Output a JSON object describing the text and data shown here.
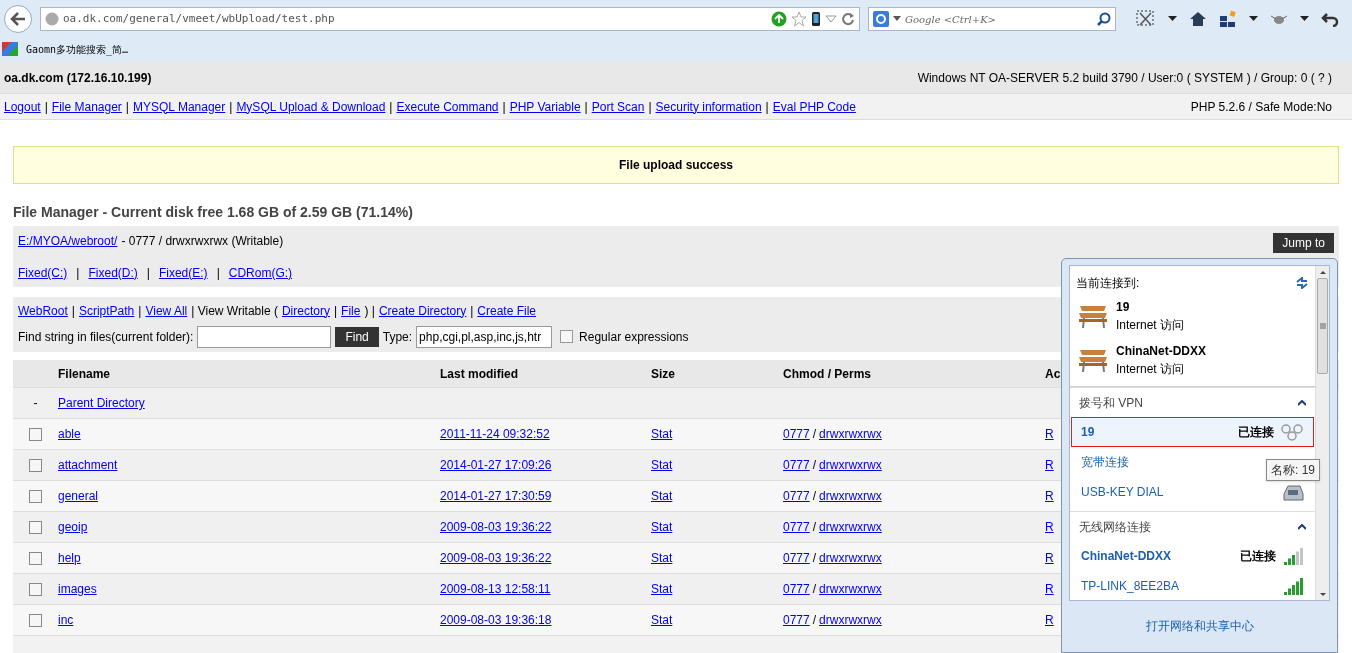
{
  "browser": {
    "url": "oa.dk.com/general/vmeet/wbUpload/test.php",
    "search_placeholder": "Google <Ctrl+K>",
    "bookmarks": [
      "Gaomn多功能搜索_简…"
    ]
  },
  "header": {
    "host": "oa.dk.com (172.16.10.199)",
    "system": "Windows NT OA-SERVER 5.2 build 3790 / User:0 ( SYSTEM ) / Group: 0 ( ? )",
    "nav": [
      {
        "kind": "link",
        "text": "Logout"
      },
      {
        "kind": "text",
        "text": "|"
      },
      {
        "kind": "link",
        "text": "File Manager"
      },
      {
        "kind": "text",
        "text": "|"
      },
      {
        "kind": "link",
        "text": "MYSQL Manager"
      },
      {
        "kind": "text",
        "text": "|"
      },
      {
        "kind": "link",
        "text": "MySQL Upload & Download"
      },
      {
        "kind": "text",
        "text": "|"
      },
      {
        "kind": "link",
        "text": "Execute Command"
      },
      {
        "kind": "text",
        "text": "|"
      },
      {
        "kind": "link",
        "text": "PHP Variable"
      },
      {
        "kind": "text",
        "text": "|"
      },
      {
        "kind": "link",
        "text": "Port Scan"
      },
      {
        "kind": "text",
        "text": "|"
      },
      {
        "kind": "link",
        "text": "Security information"
      },
      {
        "kind": "text",
        "text": "|"
      },
      {
        "kind": "link",
        "text": "Eval PHP Code"
      }
    ],
    "php": "PHP 5.2.6 / Safe Mode:No"
  },
  "notice": "File upload success",
  "title": "File Manager - Current disk free 1.68 GB of 2.59 GB (71.14%)",
  "path": {
    "link": "E:/MYOA/webroot/",
    "info": "- 0777 / drwxrwxrwx (Writable)",
    "drives": [
      {
        "kind": "link",
        "text": "Fixed(C:)"
      },
      {
        "kind": "text",
        "text": "|"
      },
      {
        "kind": "link",
        "text": "Fixed(D:)"
      },
      {
        "kind": "text",
        "text": "|"
      },
      {
        "kind": "link",
        "text": "Fixed(E:)"
      },
      {
        "kind": "text",
        "text": "|"
      },
      {
        "kind": "link",
        "text": "CDRom(G:)"
      }
    ],
    "jump_button": "Jump to"
  },
  "tools": [
    {
      "kind": "link",
      "text": "WebRoot"
    },
    {
      "kind": "text",
      "text": "|"
    },
    {
      "kind": "link",
      "text": "ScriptPath"
    },
    {
      "kind": "text",
      "text": "|"
    },
    {
      "kind": "link",
      "text": "View All"
    },
    {
      "kind": "text",
      "text": "| View Writable ("
    },
    {
      "kind": "link",
      "text": "Directory"
    },
    {
      "kind": "text",
      "text": "|"
    },
    {
      "kind": "link",
      "text": "File"
    },
    {
      "kind": "text",
      "text": ") |"
    },
    {
      "kind": "link",
      "text": "Create Directory"
    },
    {
      "kind": "text",
      "text": "|"
    },
    {
      "kind": "link",
      "text": "Create File"
    }
  ],
  "find": {
    "label": "Find string in files(current folder):",
    "button": "Find",
    "type_label": "Type:",
    "type_value": "php,cgi,pl,asp,inc,js,htr",
    "regex_label": "Regular expressions",
    "regex_checked": false
  },
  "table": {
    "columns": [
      "Filename",
      "Last modified",
      "Size",
      "Chmod / Perms",
      "Ac"
    ],
    "rows": [
      {
        "kind": "parent",
        "marker": "-",
        "name": "Parent Directory"
      },
      {
        "kind": "dir",
        "checked": false,
        "name": "able",
        "modified": "2011-11-24 09:32:52",
        "size": "Stat",
        "chmod": "0777",
        "sep": "/",
        "perms": "drwxrwxrwx",
        "action": "R"
      },
      {
        "kind": "dir",
        "checked": false,
        "name": "attachment",
        "modified": "2014-01-27 17:09:26",
        "size": "Stat",
        "chmod": "0777",
        "sep": "/",
        "perms": "drwxrwxrwx",
        "action": "R"
      },
      {
        "kind": "dir",
        "checked": false,
        "name": "general",
        "modified": "2014-01-27 17:30:59",
        "size": "Stat",
        "chmod": "0777",
        "sep": "/",
        "perms": "drwxrwxrwx",
        "action": "R"
      },
      {
        "kind": "dir",
        "checked": false,
        "name": "geoip",
        "modified": "2009-08-03 19:36:22",
        "size": "Stat",
        "chmod": "0777",
        "sep": "/",
        "perms": "drwxrwxrwx",
        "action": "R"
      },
      {
        "kind": "dir",
        "checked": false,
        "name": "help",
        "modified": "2009-08-03 19:36:22",
        "size": "Stat",
        "chmod": "0777",
        "sep": "/",
        "perms": "drwxrwxrwx",
        "action": "R"
      },
      {
        "kind": "dir",
        "checked": false,
        "name": "images",
        "modified": "2009-08-13 12:58:11",
        "size": "Stat",
        "chmod": "0777",
        "sep": "/",
        "perms": "drwxrwxrwx",
        "action": "R"
      },
      {
        "kind": "dir",
        "checked": false,
        "name": "inc",
        "modified": "2009-08-03 19:36:18",
        "size": "Stat",
        "chmod": "0777",
        "sep": "/",
        "perms": "drwxrwxrwx",
        "action": "R"
      }
    ]
  },
  "network_popup": {
    "heading": "当前连接到:",
    "connections": [
      {
        "name": "19",
        "access": "Internet 访问"
      },
      {
        "name": "ChinaNet-DDXX",
        "access": "Internet 访问"
      }
    ],
    "sections": [
      {
        "title": "拨号和 VPN",
        "expanded": true,
        "items": [
          {
            "kind": "dialup",
            "name": "19",
            "status": "已连接",
            "connected": true,
            "selected": true
          },
          {
            "kind": "plain",
            "name": "宽带连接",
            "connected": false,
            "selected": false
          },
          {
            "kind": "modem",
            "name": "USB-KEY DIAL",
            "connected": false,
            "selected": false
          }
        ]
      },
      {
        "title": "无线网络连接",
        "expanded": true,
        "items": [
          {
            "kind": "wifi",
            "name": "ChinaNet-DDXX",
            "status": "已连接",
            "connected": true,
            "selected": false,
            "level": 0.6
          },
          {
            "kind": "wifi",
            "name": "TP-LINK_8EE2BA",
            "connected": false,
            "selected": false,
            "level": 1
          }
        ]
      }
    ],
    "footer_link": "打开网络和共享中心",
    "tooltip": "名称: 19"
  }
}
